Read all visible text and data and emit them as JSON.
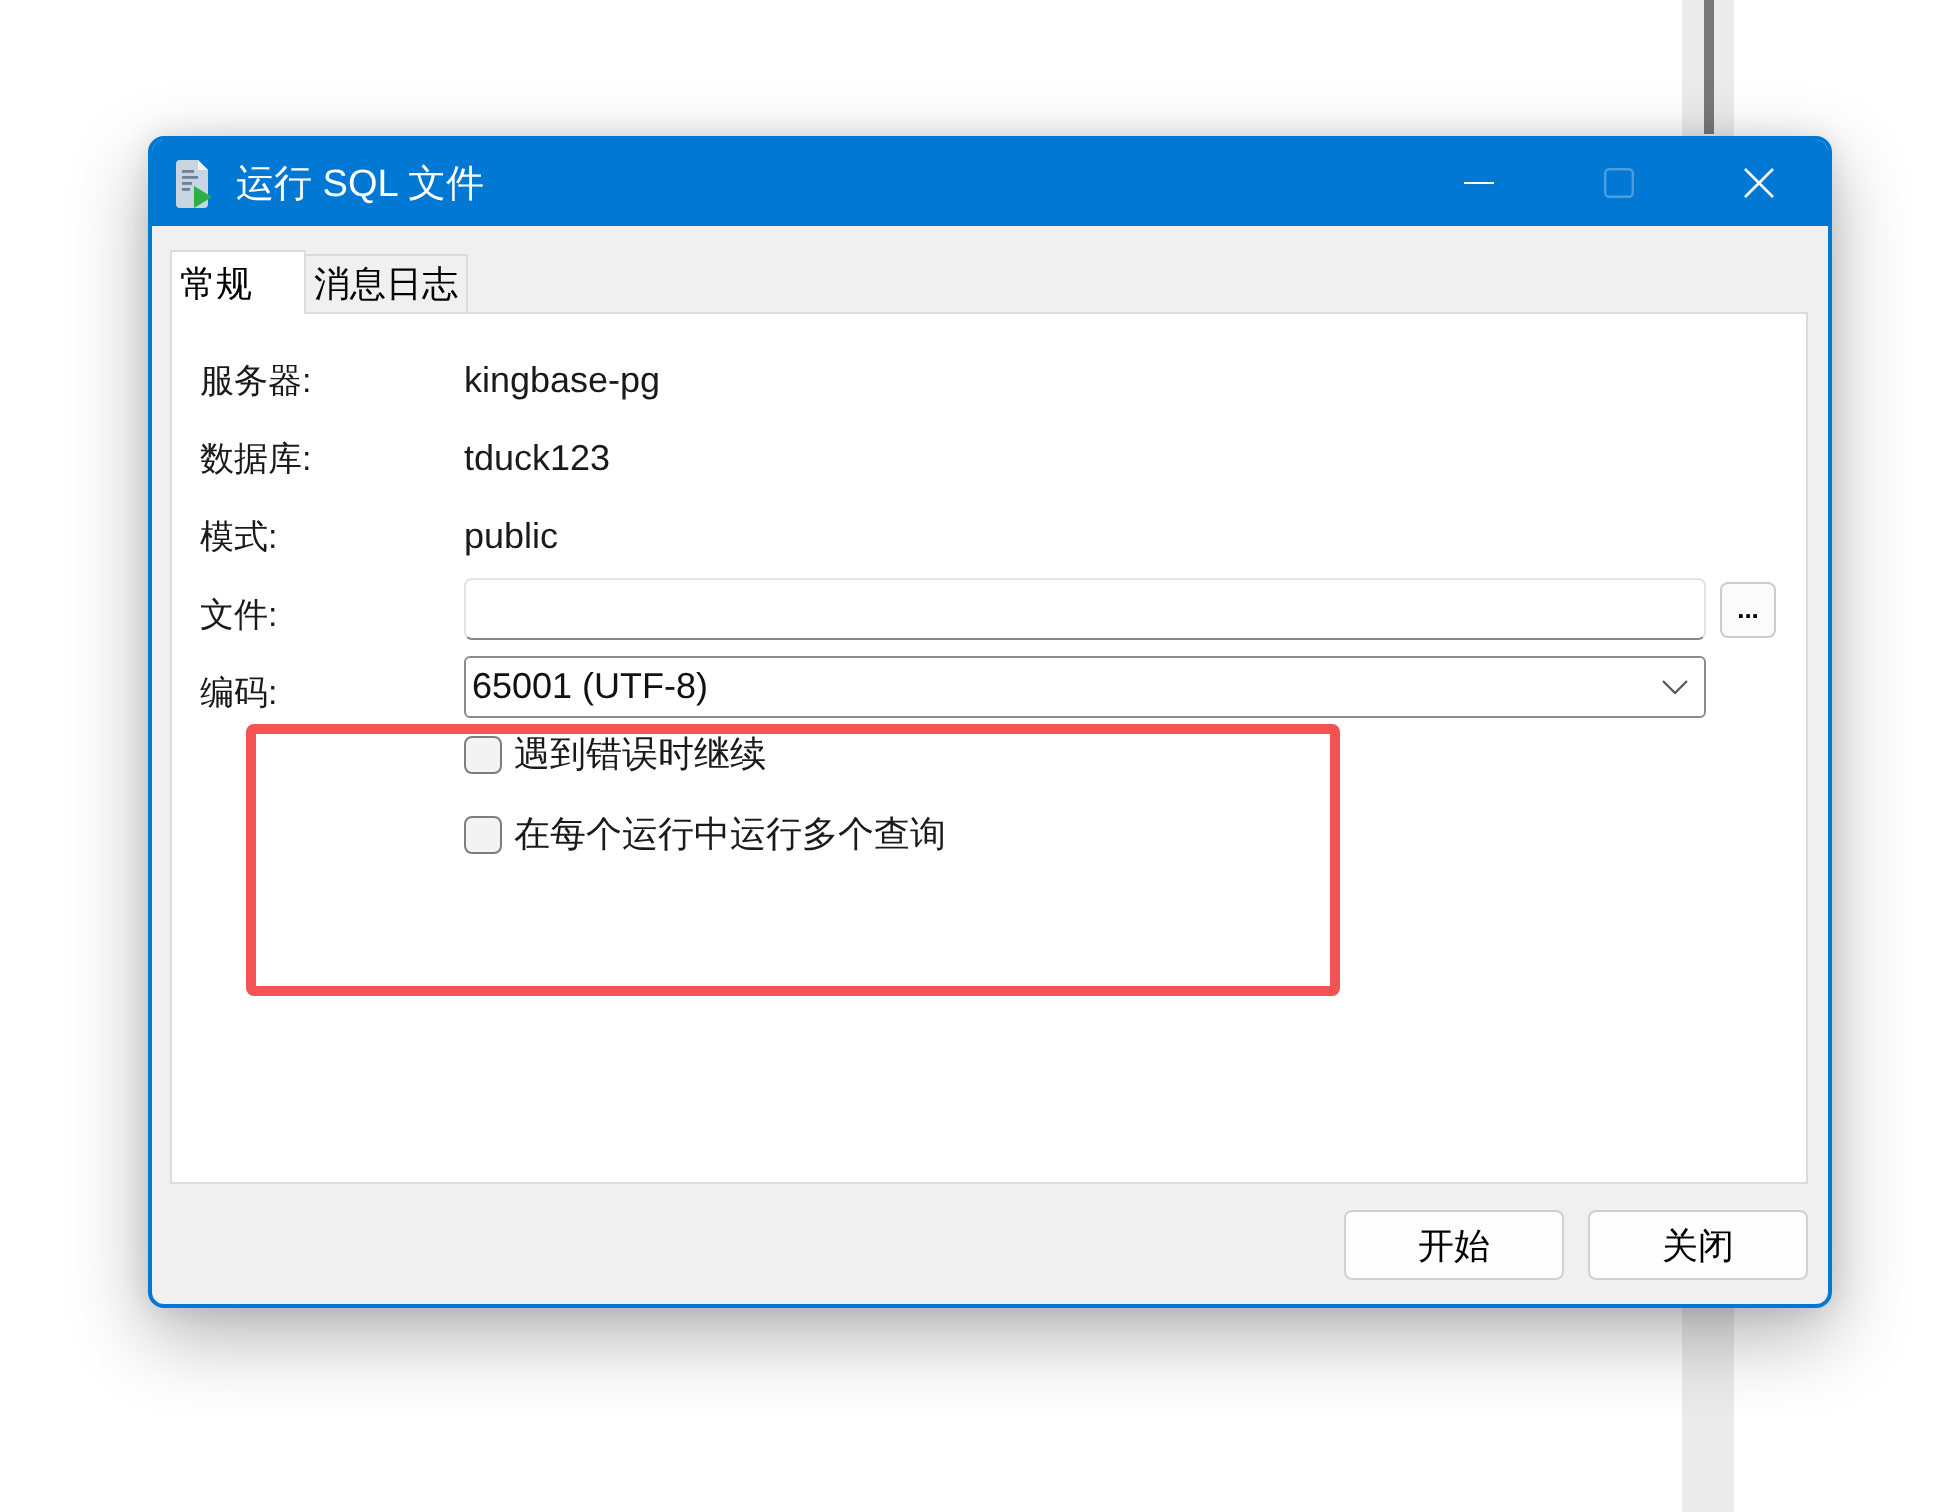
{
  "window": {
    "title": "运行 SQL 文件",
    "controls": [
      {
        "kind": "minimize",
        "disabled": false
      },
      {
        "kind": "maximize",
        "disabled": true
      },
      {
        "kind": "close",
        "disabled": false
      }
    ]
  },
  "tabs": [
    {
      "label": "常规",
      "selected": true
    },
    {
      "label": "消息日志",
      "selected": false
    }
  ],
  "info": [
    {
      "label": "服务器:",
      "value": "kingbase-pg"
    },
    {
      "label": "数据库:",
      "value": "tduck123"
    },
    {
      "label": "模式:",
      "value": "public"
    }
  ],
  "file": {
    "label": "文件:",
    "browse": "..."
  },
  "encoding": {
    "label": "编码:",
    "value": "65001 (UTF-8)"
  },
  "options": [
    {
      "label": "遇到错误时继续",
      "checked": false
    },
    {
      "label": "在每个运行中运行多个查询",
      "checked": false
    }
  ],
  "buttons": [
    "开始",
    "关闭"
  ]
}
